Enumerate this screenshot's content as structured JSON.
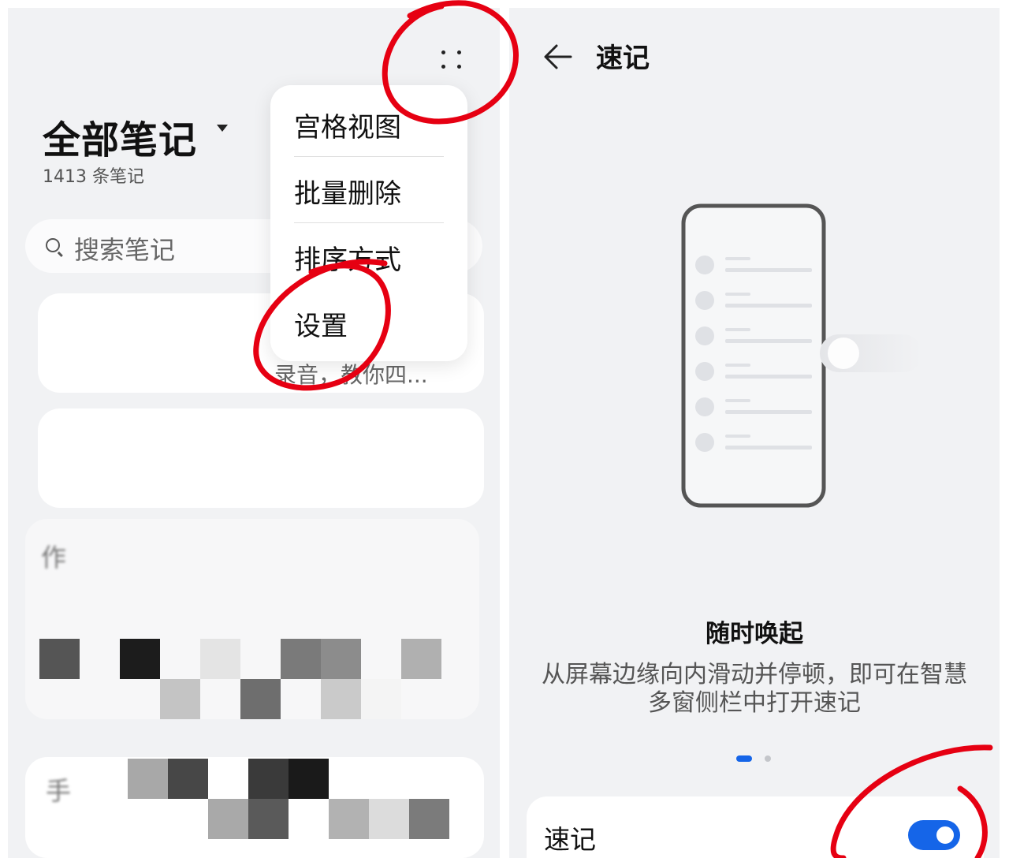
{
  "notes_list": {
    "title": "全部笔记",
    "count_text": "1413 条笔记",
    "search": {
      "placeholder": "搜索笔记"
    },
    "cards": [
      {
        "snippet": "录音，教你四..."
      },
      {
        "snippet": ""
      },
      {
        "snippet_blurred": "作"
      },
      {
        "snippet_blurred": "手"
      }
    ]
  },
  "more_menu": {
    "items": [
      {
        "label": "宫格视图"
      },
      {
        "label": "批量删除"
      },
      {
        "label": "排序方式"
      },
      {
        "label": "设置"
      }
    ]
  },
  "quick_note_settings": {
    "header_title": "速记",
    "heading": "随时唤起",
    "description": "从屏幕边缘向内滑动并停顿，即可在智慧多窗侧栏中打开速记",
    "pager": {
      "count": 2,
      "active_index": 0
    },
    "toggle": {
      "label": "速记",
      "enabled": true
    }
  },
  "colors": {
    "accent": "#1565e8",
    "annotation_red": "#e60012",
    "panel_background": "#f1f2f4"
  },
  "icons": [
    "more-icon",
    "dropdown-caret-icon",
    "search-icon",
    "back-arrow-icon"
  ]
}
